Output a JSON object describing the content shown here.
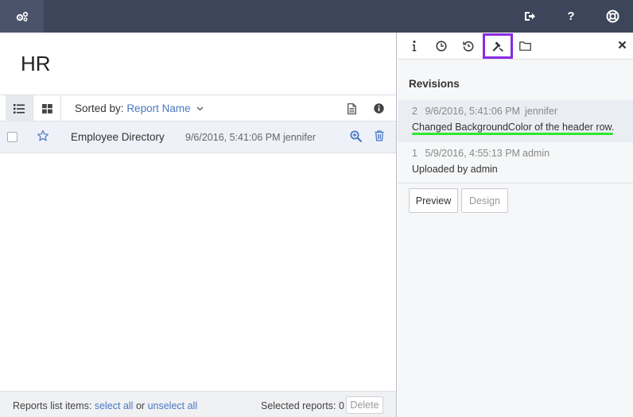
{
  "topbar": {
    "icons": [
      "settings-cogs-icon",
      "logout-icon",
      "help-icon",
      "support-lifebuoy-icon"
    ]
  },
  "left": {
    "title": "HR",
    "toolbar": {
      "sorted_label": "Sorted by:",
      "sorted_value": "Report Name"
    },
    "reports": [
      {
        "name": "Employee Directory",
        "date": "9/6/2016, 5:41:06 PM",
        "user": "jennifer"
      }
    ],
    "footer": {
      "list_label": "Reports list items:",
      "select_all": "select all",
      "or": "or",
      "unselect_all": "unselect all",
      "selected_label": "Selected reports: 0",
      "delete_label": "Delete"
    }
  },
  "right": {
    "title": "Revisions",
    "revisions": [
      {
        "num": "2",
        "date": "9/6/2016, 5:41:06 PM",
        "user": "jennifer",
        "message": "Changed BackgroundColor of the header row."
      },
      {
        "num": "1",
        "date": "5/9/2016, 4:55:13 PM",
        "user": "admin",
        "message": "Uploaded by admin"
      }
    ],
    "preview_label": "Preview",
    "design_label": "Design"
  },
  "colors": {
    "topbar": "#3c4559",
    "link": "#4a79c4",
    "active_tab_outline": "#8a2be2",
    "highlight_underline": "#2ee82e"
  }
}
